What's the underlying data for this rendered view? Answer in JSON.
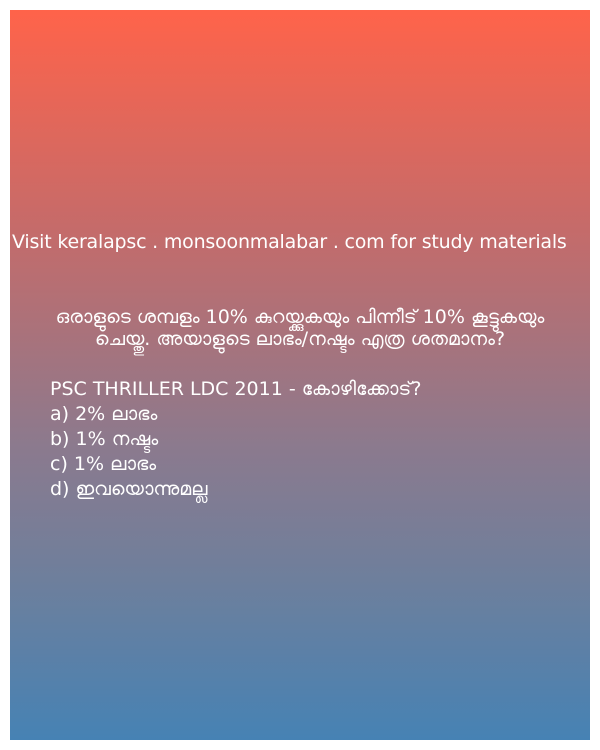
{
  "card": {
    "gradient_top": "#ff634a",
    "gradient_bottom": "#4682b4",
    "site_line": "Visit keralapsc . monsoonmalabar . com for study materials",
    "question_line1": "ഒരാളുടെ ശമ്പളം 10% കുറയ്ക്കുകയും പിന്നീട് 10% കൂട്ടുകയും",
    "question_line2": "ചെയ്തു. അയാളുടെ ലാഭം/നഷ്ടം എത്ര ശതമാനം?",
    "source": "PSC THRILLER  LDC 2011 - കോഴിക്കോട്?",
    "options": [
      "a) 2% ലാഭം",
      "b) 1% നഷ്ടം",
      "c) 1% ലാഭം",
      "d) ഇവയൊന്നുമല്ല"
    ]
  }
}
